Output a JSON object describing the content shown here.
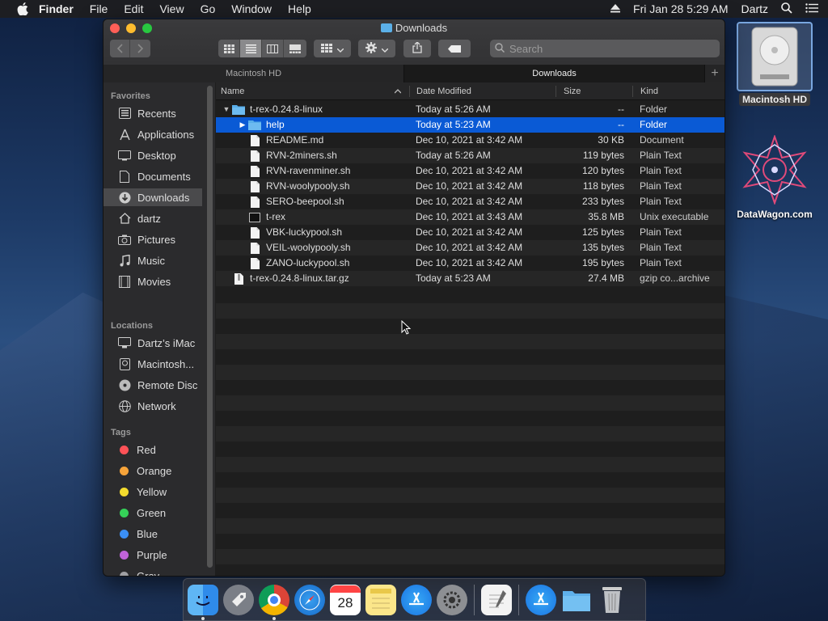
{
  "menubar": {
    "app": "Finder",
    "items": [
      "File",
      "Edit",
      "View",
      "Go",
      "Window",
      "Help"
    ],
    "datetime": "Fri Jan 28  5:29 AM",
    "user": "Dartz"
  },
  "window": {
    "title": "Downloads",
    "search_placeholder": "Search",
    "tabs": [
      "Macintosh HD",
      "Downloads"
    ]
  },
  "columns": {
    "name": "Name",
    "date": "Date Modified",
    "size": "Size",
    "kind": "Kind"
  },
  "sidebar": {
    "favorites_label": "Favorites",
    "favorites": [
      "Recents",
      "Applications",
      "Desktop",
      "Documents",
      "Downloads",
      "dartz",
      "Pictures",
      "Music",
      "Movies"
    ],
    "locations_label": "Locations",
    "locations": [
      "Dartz’s iMac",
      "Macintosh...",
      "Remote Disc",
      "Network"
    ],
    "tags_label": "Tags",
    "tags": [
      {
        "name": "Red",
        "color": "#ff5257"
      },
      {
        "name": "Orange",
        "color": "#f7a43a"
      },
      {
        "name": "Yellow",
        "color": "#f4dc2e"
      },
      {
        "name": "Green",
        "color": "#35d158"
      },
      {
        "name": "Blue",
        "color": "#3b8ff5"
      },
      {
        "name": "Purple",
        "color": "#c063d9"
      },
      {
        "name": "Gray",
        "color": "#a0a0a4"
      }
    ]
  },
  "files": [
    {
      "name": "t-rex-0.24.8-linux",
      "date": "Today at 5:26 AM",
      "size": "--",
      "kind": "Folder"
    },
    {
      "name": "help",
      "date": "Today at 5:23 AM",
      "size": "--",
      "kind": "Folder"
    },
    {
      "name": "README.md",
      "date": "Dec 10, 2021 at 3:42 AM",
      "size": "30 KB",
      "kind": "Document"
    },
    {
      "name": "RVN-2miners.sh",
      "date": "Today at 5:26 AM",
      "size": "119 bytes",
      "kind": "Plain Text"
    },
    {
      "name": "RVN-ravenminer.sh",
      "date": "Dec 10, 2021 at 3:42 AM",
      "size": "120 bytes",
      "kind": "Plain Text"
    },
    {
      "name": "RVN-woolypooly.sh",
      "date": "Dec 10, 2021 at 3:42 AM",
      "size": "118 bytes",
      "kind": "Plain Text"
    },
    {
      "name": "SERO-beepool.sh",
      "date": "Dec 10, 2021 at 3:42 AM",
      "size": "233 bytes",
      "kind": "Plain Text"
    },
    {
      "name": "t-rex",
      "date": "Dec 10, 2021 at 3:43 AM",
      "size": "35.8 MB",
      "kind": "Unix executable"
    },
    {
      "name": "VBK-luckypool.sh",
      "date": "Dec 10, 2021 at 3:42 AM",
      "size": "125 bytes",
      "kind": "Plain Text"
    },
    {
      "name": "VEIL-woolypooly.sh",
      "date": "Dec 10, 2021 at 3:42 AM",
      "size": "135 bytes",
      "kind": "Plain Text"
    },
    {
      "name": "ZANO-luckypool.sh",
      "date": "Dec 10, 2021 at 3:42 AM",
      "size": "195 bytes",
      "kind": "Plain Text"
    },
    {
      "name": "t-rex-0.24.8-linux.tar.gz",
      "date": "Today at 5:23 AM",
      "size": "27.4 MB",
      "kind": "gzip co...archive"
    }
  ],
  "desktop": {
    "hd_label": "Macintosh HD",
    "datawagon_label": "DataWagon.com"
  }
}
